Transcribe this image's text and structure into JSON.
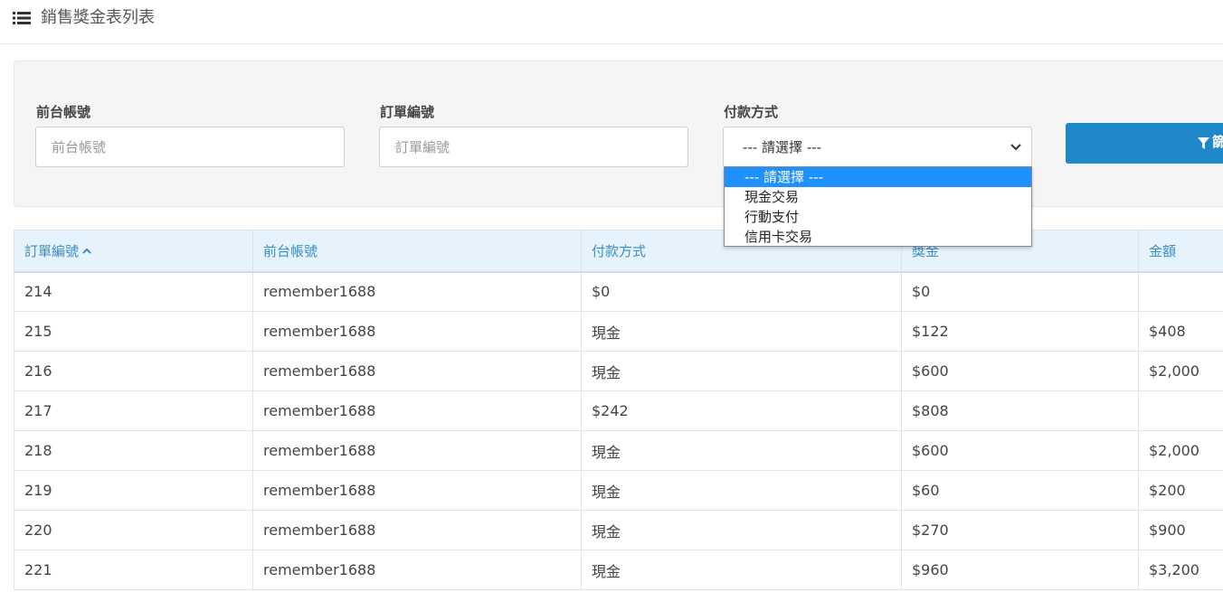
{
  "header": {
    "title": "銷售獎金表列表",
    "icon": "list-icon"
  },
  "filters": {
    "account": {
      "label": "前台帳號",
      "placeholder": "前台帳號",
      "value": ""
    },
    "order_no": {
      "label": "訂單編號",
      "placeholder": "訂單編號",
      "value": ""
    },
    "payment": {
      "label": "付款方式",
      "selected": "--- 請選擇 ---",
      "options": [
        "--- 請選擇 ---",
        "現金交易",
        "行動支付",
        "信用卡交易"
      ]
    },
    "button": {
      "label": "篩",
      "icon": "filter-icon"
    }
  },
  "table": {
    "columns": [
      "訂單編號",
      "前台帳號",
      "付款方式",
      "獎金",
      "金額"
    ],
    "sorted_column": 0,
    "sort_direction": "asc",
    "rows": [
      [
        "214",
        "remember1688",
        "$0",
        "$0",
        ""
      ],
      [
        "215",
        "remember1688",
        "現金",
        "$122",
        "$408"
      ],
      [
        "216",
        "remember1688",
        "現金",
        "$600",
        "$2,000"
      ],
      [
        "217",
        "remember1688",
        "$242",
        "$808",
        ""
      ],
      [
        "218",
        "remember1688",
        "現金",
        "$600",
        "$2,000"
      ],
      [
        "219",
        "remember1688",
        "現金",
        "$60",
        "$200"
      ],
      [
        "220",
        "remember1688",
        "現金",
        "$270",
        "$900"
      ],
      [
        "221",
        "remember1688",
        "現金",
        "$960",
        "$3,200"
      ]
    ]
  },
  "colors": {
    "accent": "#1e88c8",
    "header_bg": "#e6f2fc",
    "header_text": "#3a8fc9",
    "highlight": "#1e90ff"
  }
}
